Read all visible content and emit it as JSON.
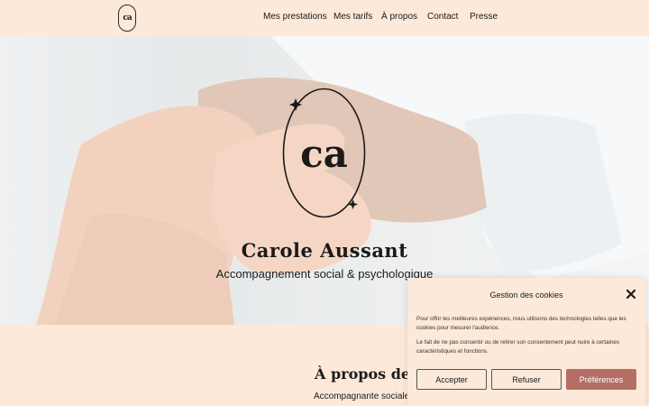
{
  "header": {
    "logo_text": "ca",
    "nav": [
      "Mes prestations",
      "Mes tarifs",
      "À propos",
      "Contact",
      "Presse"
    ]
  },
  "hero": {
    "emblem_text": "ca",
    "title": "Carole Aussant",
    "subtitle": "Accompagnement social & psychologique"
  },
  "about": {
    "title": "À propos de n",
    "text": "Accompagnante sociale &"
  },
  "cookie": {
    "title": "Gestion des cookies",
    "paragraph1": "Pour offrir les meilleures expériences, nous utilisons des technologies telles que les cookies pour mesurer l'audience.",
    "paragraph2": "Le fait de ne pas consentir ou de retirer son consentement peut nuire à certaines caractéristiques et fonctions.",
    "accept_label": "Accepter",
    "refuse_label": "Refuser",
    "prefs_label": "Préférences"
  },
  "colors": {
    "background": "#fde9d9",
    "accent": "#b46e64"
  }
}
